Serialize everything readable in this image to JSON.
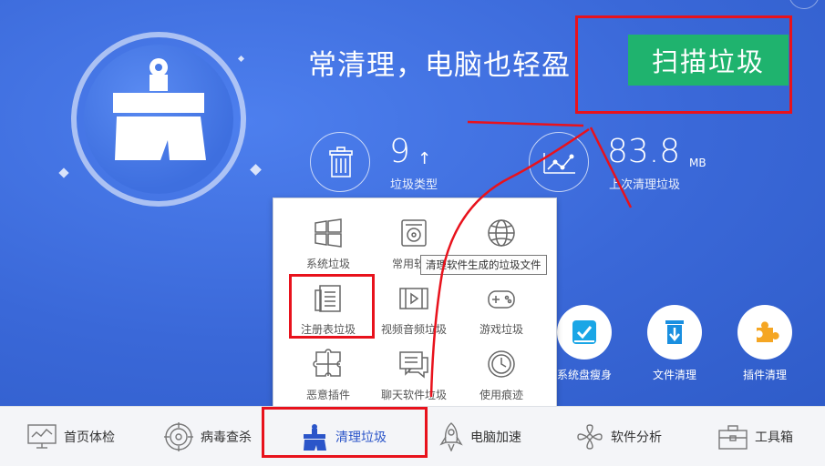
{
  "header": {
    "headline": "常清理，电脑也轻盈",
    "scan_button": "扫描垃圾"
  },
  "stats": {
    "junk_types": {
      "value": "9",
      "arrow": "↑",
      "label": "垃圾类型"
    },
    "last_cleaned": {
      "value": "83.8",
      "unit": "MB",
      "label": "上次清理垃圾"
    }
  },
  "popup": {
    "items": [
      {
        "label": "系统垃圾",
        "icon": "windows-icon"
      },
      {
        "label": "常用软件",
        "icon": "software-disk-icon"
      },
      {
        "label": "",
        "icon": "globe-icon"
      },
      {
        "label": "注册表垃圾",
        "icon": "registry-icon"
      },
      {
        "label": "视频音频垃圾",
        "icon": "video-icon"
      },
      {
        "label": "游戏垃圾",
        "icon": "gamepad-icon"
      },
      {
        "label": "恶意插件",
        "icon": "puzzle-icon"
      },
      {
        "label": "聊天软件垃圾",
        "icon": "chat-icon"
      },
      {
        "label": "使用痕迹",
        "icon": "clock-icon"
      }
    ],
    "tooltip": "清理软件生成的垃圾文件"
  },
  "tools": [
    {
      "label": "系统盘瘦身",
      "icon": "disk-slim-icon"
    },
    {
      "label": "文件清理",
      "icon": "trash-download-icon"
    },
    {
      "label": "插件清理",
      "icon": "plugin-icon"
    }
  ],
  "nav": [
    {
      "label": "首页体检",
      "icon": "monitor-icon"
    },
    {
      "label": "病毒查杀",
      "icon": "target-icon"
    },
    {
      "label": "清理垃圾",
      "icon": "broom-icon",
      "active": true
    },
    {
      "label": "电脑加速",
      "icon": "rocket-icon"
    },
    {
      "label": "软件分析",
      "icon": "fan-icon"
    },
    {
      "label": "工具箱",
      "icon": "toolbox-icon"
    }
  ],
  "colors": {
    "hero_blue": "#3a68d8",
    "scan_green": "#1fb36e",
    "active_nav": "#2b55c9",
    "annotation_red": "#e8121c"
  }
}
